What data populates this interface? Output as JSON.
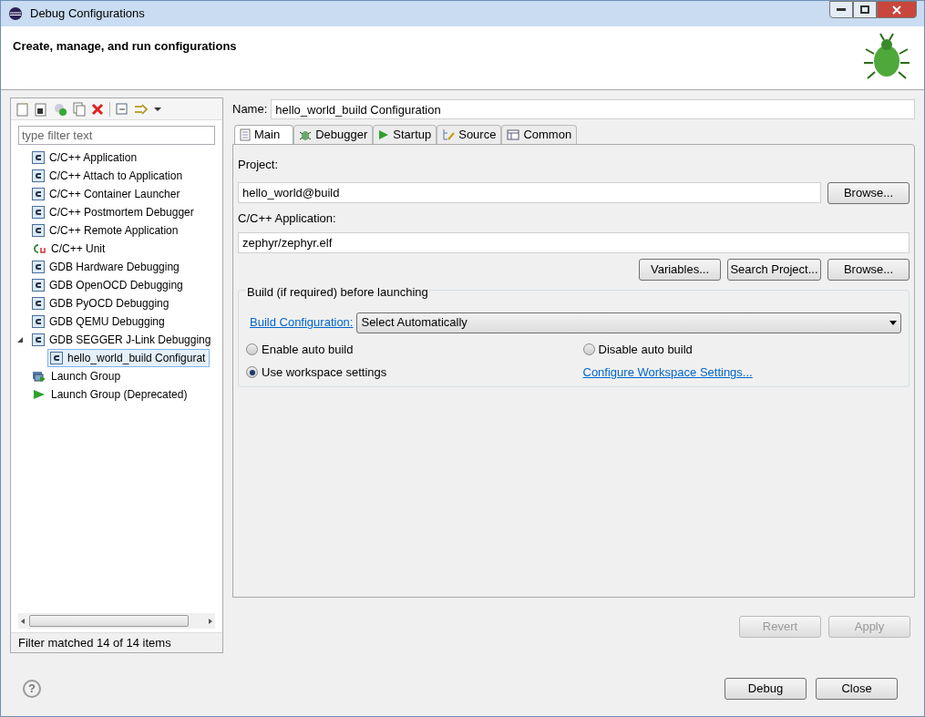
{
  "window": {
    "title": "Debug Configurations"
  },
  "header": {
    "title": "Create, manage, and run configurations"
  },
  "sidebar": {
    "filter_placeholder": "type filter text",
    "items": [
      {
        "label": "C/C++ Application",
        "kind": "c",
        "selected": false
      },
      {
        "label": "C/C++ Attach to Application",
        "kind": "c",
        "selected": false
      },
      {
        "label": "C/C++ Container Launcher",
        "kind": "c",
        "selected": false
      },
      {
        "label": "C/C++ Postmortem Debugger",
        "kind": "c",
        "selected": false
      },
      {
        "label": "C/C++ Remote Application",
        "kind": "c",
        "selected": false
      },
      {
        "label": "C/C++ Unit",
        "kind": "unit",
        "selected": false
      },
      {
        "label": "GDB Hardware Debugging",
        "kind": "c",
        "selected": false
      },
      {
        "label": "GDB OpenOCD Debugging",
        "kind": "c",
        "selected": false
      },
      {
        "label": "GDB PyOCD Debugging",
        "kind": "c",
        "selected": false
      },
      {
        "label": "GDB QEMU Debugging",
        "kind": "c",
        "selected": false
      },
      {
        "label": "GDB SEGGER J-Link Debugging",
        "kind": "c",
        "selected": false,
        "expanded": true,
        "children": [
          {
            "label": "hello_world_build Configurat",
            "kind": "c",
            "selected": true
          }
        ]
      },
      {
        "label": "Launch Group",
        "kind": "group",
        "selected": false
      },
      {
        "label": "Launch Group (Deprecated)",
        "kind": "play",
        "selected": false
      }
    ],
    "status": "Filter matched 14 of 14 items"
  },
  "config": {
    "name_label": "Name:",
    "name": "hello_world_build Configuration",
    "tabs": [
      {
        "label": "Main",
        "kind": "main",
        "selected": true
      },
      {
        "label": "Debugger",
        "kind": "debugger",
        "selected": false
      },
      {
        "label": "Startup",
        "kind": "startup",
        "selected": false
      },
      {
        "label": "Source",
        "kind": "source",
        "selected": false
      },
      {
        "label": "Common",
        "kind": "common",
        "selected": false
      }
    ],
    "project_label": "Project:",
    "project": "hello_world@build",
    "project_browse": "Browse...",
    "app_label": "C/C++ Application:",
    "app": "zephyr/zephyr.elf",
    "app_buttons": [
      "Variables...",
      "Search Project...",
      "Browse..."
    ],
    "build": {
      "title": "Build (if required) before launching",
      "config_link": "Build Configuration:",
      "config_value": "Select Automatically",
      "options": [
        {
          "label": "Enable auto build",
          "selected": false
        },
        {
          "label": "Disable auto build",
          "selected": false
        },
        {
          "label": "Use workspace settings",
          "selected": true
        }
      ],
      "workspace_link": "Configure Workspace Settings..."
    },
    "revert": "Revert",
    "apply": "Apply"
  },
  "footer": {
    "buttons": [
      "Debug",
      "Close"
    ],
    "help": "?"
  }
}
